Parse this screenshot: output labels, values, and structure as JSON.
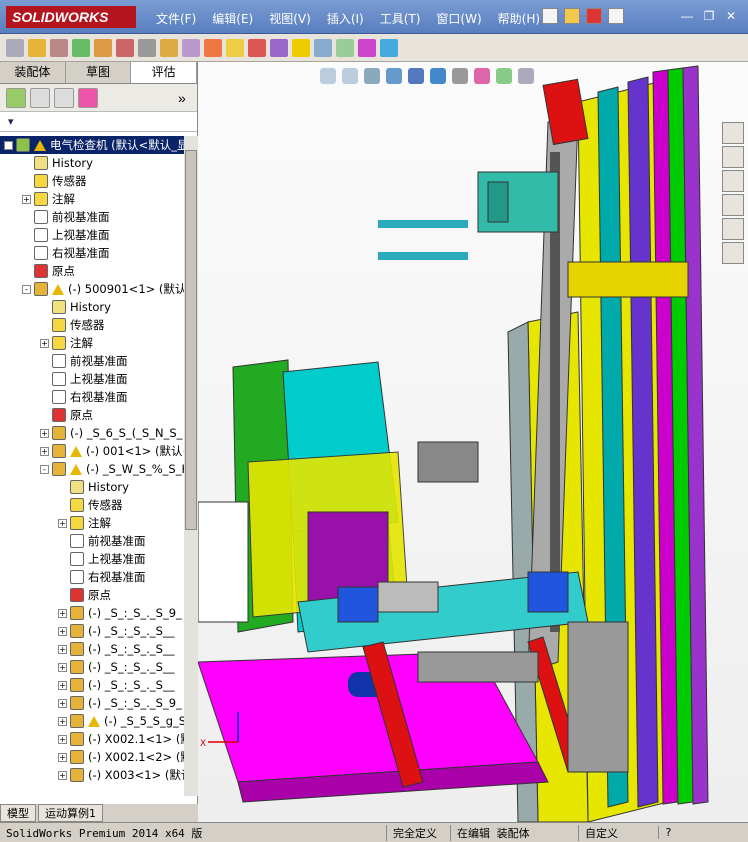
{
  "app": {
    "logo": "SOLIDWORKS"
  },
  "menu": [
    "文件(F)",
    "编辑(E)",
    "视图(V)",
    "插入(I)",
    "工具(T)",
    "窗口(W)",
    "帮助(H)"
  ],
  "panel_tabs": [
    "装配体",
    "草图",
    "评估"
  ],
  "filter_text": "▾",
  "tree": [
    {
      "label": "电气检查机 (默认<默认_显",
      "level": 0,
      "exp": "-",
      "icon": "assembly-icon",
      "warn": true,
      "sel": true
    },
    {
      "label": "History",
      "level": 1,
      "exp": "",
      "icon": "history-icon"
    },
    {
      "label": "传感器",
      "level": 1,
      "exp": "",
      "icon": "sensor-icon"
    },
    {
      "label": "注解",
      "level": 1,
      "exp": "+",
      "icon": "annotation-icon"
    },
    {
      "label": "前视基准面",
      "level": 1,
      "exp": "",
      "icon": "plane-icon"
    },
    {
      "label": "上视基准面",
      "level": 1,
      "exp": "",
      "icon": "plane-icon"
    },
    {
      "label": "右视基准面",
      "level": 1,
      "exp": "",
      "icon": "plane-icon"
    },
    {
      "label": "原点",
      "level": 1,
      "exp": "",
      "icon": "origin-icon"
    },
    {
      "label": "(-) 500901<1> (默认<",
      "level": 1,
      "exp": "-",
      "icon": "subassembly-icon",
      "warn": true
    },
    {
      "label": "History",
      "level": 2,
      "exp": "",
      "icon": "history-icon"
    },
    {
      "label": "传感器",
      "level": 2,
      "exp": "",
      "icon": "sensor-icon"
    },
    {
      "label": "注解",
      "level": 2,
      "exp": "+",
      "icon": "annotation-icon"
    },
    {
      "label": "前视基准面",
      "level": 2,
      "exp": "",
      "icon": "plane-icon"
    },
    {
      "label": "上视基准面",
      "level": 2,
      "exp": "",
      "icon": "plane-icon"
    },
    {
      "label": "右视基准面",
      "level": 2,
      "exp": "",
      "icon": "plane-icon"
    },
    {
      "label": "原点",
      "level": 2,
      "exp": "",
      "icon": "origin-icon"
    },
    {
      "label": "(-) _S_6_S_(_S_N_S_",
      "level": 2,
      "exp": "+",
      "icon": "subassembly-icon"
    },
    {
      "label": "(-) 001<1> (默认<",
      "level": 2,
      "exp": "+",
      "icon": "subassembly-icon",
      "warn": true
    },
    {
      "label": "(-) _S_W_S_%_S_H_",
      "level": 2,
      "exp": "-",
      "icon": "subassembly-icon",
      "warn": true
    },
    {
      "label": "History",
      "level": 3,
      "exp": "",
      "icon": "history-icon"
    },
    {
      "label": "传感器",
      "level": 3,
      "exp": "",
      "icon": "sensor-icon"
    },
    {
      "label": "注解",
      "level": 3,
      "exp": "+",
      "icon": "annotation-icon"
    },
    {
      "label": "前视基准面",
      "level": 3,
      "exp": "",
      "icon": "plane-icon"
    },
    {
      "label": "上视基准面",
      "level": 3,
      "exp": "",
      "icon": "plane-icon"
    },
    {
      "label": "右视基准面",
      "level": 3,
      "exp": "",
      "icon": "plane-icon"
    },
    {
      "label": "原点",
      "level": 3,
      "exp": "",
      "icon": "origin-icon"
    },
    {
      "label": "(-) _S_:_S_._S_9_",
      "level": 3,
      "exp": "+",
      "icon": "part-icon"
    },
    {
      "label": "(-) _S_:_S_._S__",
      "level": 3,
      "exp": "+",
      "icon": "part-icon"
    },
    {
      "label": "(-) _S_:_S_._S__",
      "level": 3,
      "exp": "+",
      "icon": "part-icon"
    },
    {
      "label": "(-) _S_:_S_._S__",
      "level": 3,
      "exp": "+",
      "icon": "part-icon"
    },
    {
      "label": "(-) _S_:_S_._S__",
      "level": 3,
      "exp": "+",
      "icon": "part-icon"
    },
    {
      "label": "(-) _S_:_S_._S_9_",
      "level": 3,
      "exp": "+",
      "icon": "part-icon"
    },
    {
      "label": "(-) _S_5_S_g_S",
      "level": 3,
      "exp": "+",
      "icon": "subassembly-icon",
      "warn": true
    },
    {
      "label": "(-) X002.1<1> (默",
      "level": 3,
      "exp": "+",
      "icon": "part-icon"
    },
    {
      "label": "(-) X002.1<2> (默",
      "level": 3,
      "exp": "+",
      "icon": "part-icon"
    },
    {
      "label": "(-) X003<1> (默认",
      "level": 3,
      "exp": "+",
      "icon": "part-icon"
    }
  ],
  "bottom_tabs": [
    "模型",
    "运动算例1"
  ],
  "status": {
    "app": "SolidWorks Premium 2014 x64 版",
    "def": "完全定义",
    "edit": "在编辑 装配体",
    "custom": "自定义"
  },
  "colors": {
    "accent": "#0a246a",
    "title": "#5a7fc0"
  }
}
